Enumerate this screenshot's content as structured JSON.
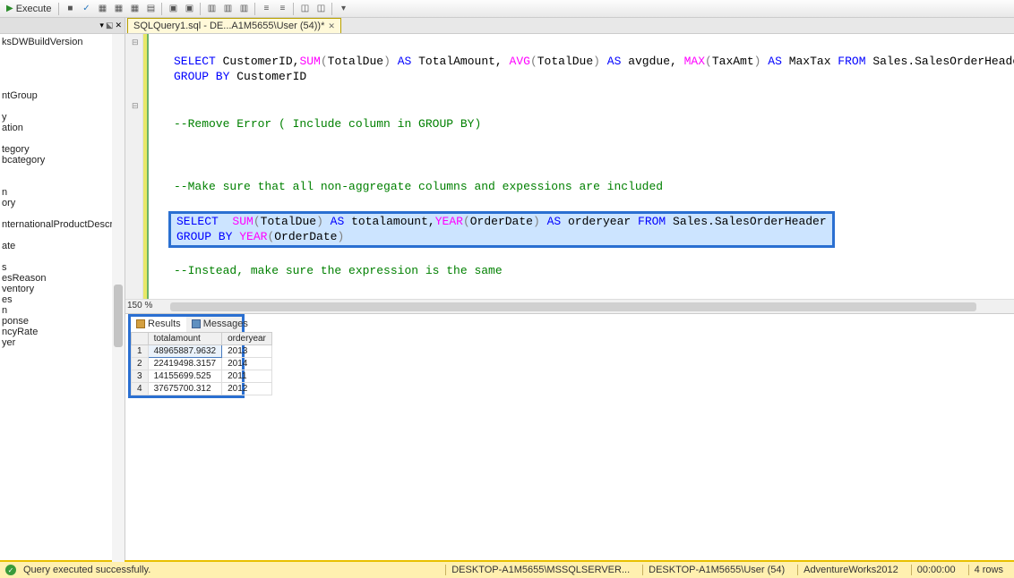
{
  "toolbar": {
    "execute_label": "Execute"
  },
  "tab": {
    "title": "SQLQuery1.sql - DE...A1M5655\\User (54))*"
  },
  "object_explorer": {
    "items": [
      "ksDWBuildVersion",
      "",
      "",
      "",
      "",
      "ntGroup",
      "",
      "y",
      "ation",
      "",
      "tegory",
      "bcategory",
      "",
      "",
      "n",
      "ory",
      "",
      "nternationalProductDescription",
      "",
      "ate",
      "",
      "s",
      "esReason",
      "ventory",
      "es",
      "n",
      "ponse",
      "ncyRate",
      "yer"
    ]
  },
  "code": {
    "l1_select": "SELECT",
    "l1_rest1": " CustomerID,",
    "l1_sum": "SUM",
    "l1_p1": "(",
    "l1_td1": "TotalDue",
    "l1_p2": ")",
    "l1_as1": " AS ",
    "l1_tot": "TotalAmount, ",
    "l1_avg": "AVG",
    "l1_p3": "(",
    "l1_td2": "TotalDue",
    "l1_p4": ")",
    "l1_as2": " AS ",
    "l1_ad": "avgdue, ",
    "l1_max": "MAX",
    "l1_p5": "(",
    "l1_tax": "TaxAmt",
    "l1_p6": ")",
    "l1_as3": " AS ",
    "l1_mt": "MaxTax ",
    "l1_from": "FROM ",
    "l1_tbl": "Sales.SalesOrderHeader",
    "l2_gb": "GROUP BY ",
    "l2_c": "CustomerID",
    "c1": "--Remove Error ( Include column in GROUP BY)",
    "c2": "--Make sure that all non-aggregate columns and expessions are included",
    "h1_select": "SELECT  ",
    "h1_sum": "SUM",
    "h1_p1": "(",
    "h1_td": "TotalDue",
    "h1_p2": ")",
    "h1_as1": " AS ",
    "h1_tot": "totalamount,",
    "h1_year": "YEAR",
    "h1_p3": "(",
    "h1_od": "OrderDate",
    "h1_p4": ")",
    "h1_as2": " AS ",
    "h1_oy": "orderyear ",
    "h1_from": "FROM ",
    "h1_tbl": "Sales.SalesOrderHeader",
    "h2_gb": "GROUP BY ",
    "h2_year": "YEAR",
    "h2_p1": "(",
    "h2_od": "OrderDate",
    "h2_p2": ")",
    "c3": "--Instead, make sure the expression is the same",
    "zoom": "150 %"
  },
  "results": {
    "tab1": "Results",
    "tab2": "Messages",
    "cols": [
      "totalamount",
      "orderyear"
    ],
    "rows": [
      {
        "n": "1",
        "a": "48965887.9632",
        "b": "2013"
      },
      {
        "n": "2",
        "a": "22419498.3157",
        "b": "2014"
      },
      {
        "n": "3",
        "a": "14155699.525",
        "b": "2011"
      },
      {
        "n": "4",
        "a": "37675700.312",
        "b": "2012"
      }
    ]
  },
  "status": {
    "msg": "Query executed successfully.",
    "srv": "DESKTOP-A1M5655\\MSSQLSERVER...",
    "usr": "DESKTOP-A1M5655\\User (54)",
    "db": "AdventureWorks2012",
    "time": "00:00:00",
    "rows": "4 rows"
  }
}
